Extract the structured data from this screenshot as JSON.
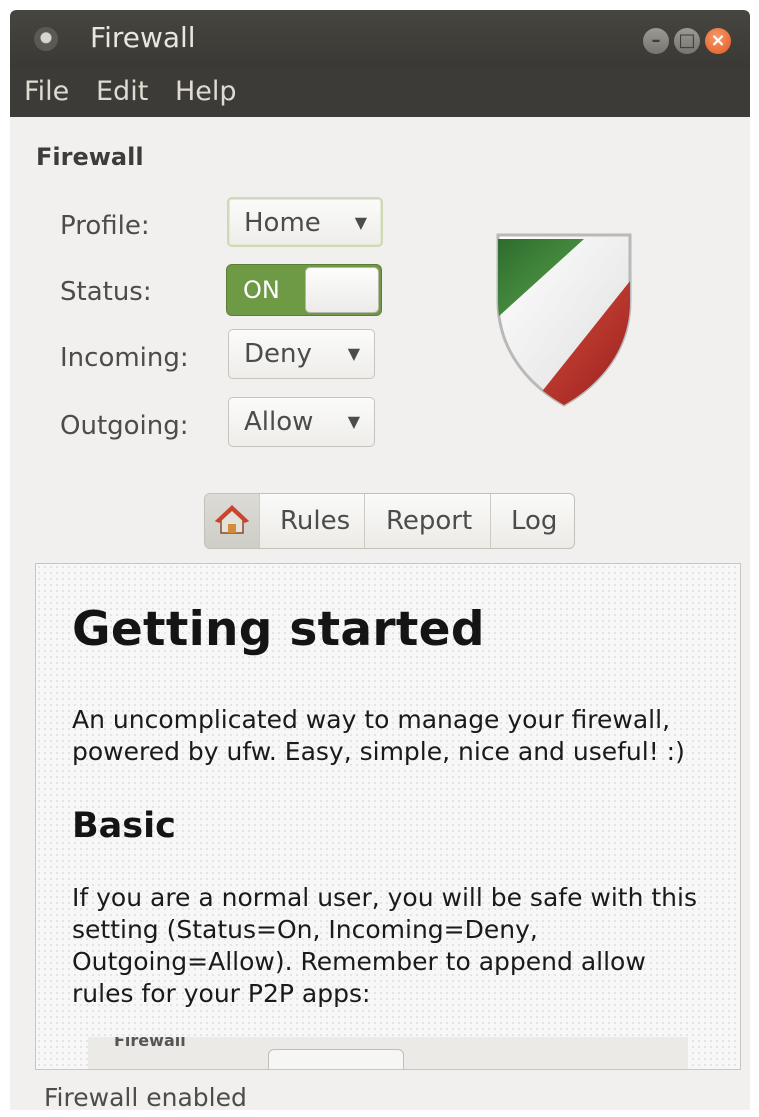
{
  "window": {
    "title": "Firewall",
    "controls": {
      "minimize_icon": "minimize-icon",
      "maximize_icon": "maximize-icon",
      "close_icon": "close-icon"
    }
  },
  "menubar": {
    "items": [
      "File",
      "Edit",
      "Help"
    ]
  },
  "firewall": {
    "section_title": "Firewall",
    "profile": {
      "label": "Profile:",
      "value": "Home"
    },
    "status": {
      "label": "Status:",
      "value": "ON",
      "enabled": true
    },
    "incoming": {
      "label": "Incoming:",
      "value": "Deny"
    },
    "outgoing": {
      "label": "Outgoing:",
      "value": "Allow"
    }
  },
  "tabs": {
    "home_icon": "home-icon",
    "items": [
      "Rules",
      "Report",
      "Log"
    ]
  },
  "document": {
    "heading": "Getting started",
    "intro": "An uncomplicated way to manage your firewall, powered by ufw. Easy, simple, nice and useful! :)",
    "subheading": "Basic",
    "basic_text": "If you are a normal user, you will be safe with this setting (Status=On, Incoming=Deny, Outgoing=Allow). Remember to append allow rules for your P2P apps:",
    "embedded_screenshot_text": "Firewall"
  },
  "statusbar": {
    "text": "Firewall enabled"
  },
  "colors": {
    "titlebar": "#3c3b37",
    "window_bg": "#f1f0ee",
    "switch_on": "#6e9a45",
    "close_button": "#e3581f"
  }
}
